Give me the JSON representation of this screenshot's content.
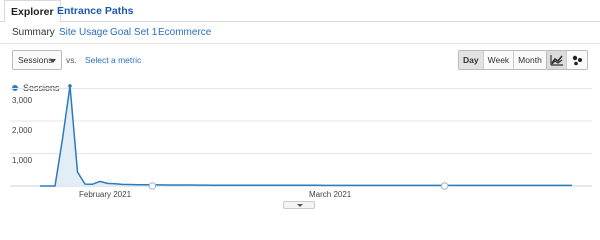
{
  "tabs": [
    {
      "label": "Explorer",
      "active": true
    },
    {
      "label": "Entrance Paths",
      "active": false
    }
  ],
  "subnav": [
    "Summary",
    "Site Usage",
    "Goal Set 1",
    "Ecommerce"
  ],
  "controls": {
    "metric_selected": "Sessions",
    "vs_label": "vs.",
    "select_metric_link": "Select a metric",
    "periods": [
      "Day",
      "Week",
      "Month"
    ],
    "active_period": "Day",
    "chart_type_icons": [
      "line-chart-icon",
      "motion-chart-icon"
    ]
  },
  "colors": {
    "series": "#2b7bbf",
    "fill": "#e3edf6",
    "link": "#2a6fc0",
    "grid": "#e6e6e6"
  },
  "chart_data": {
    "type": "area",
    "legend": [
      "Sessions"
    ],
    "yticks": [
      "3,000",
      "2,000",
      "1,000"
    ],
    "ylim": [
      0,
      3200
    ],
    "xtick_labels": [
      "February 2021",
      "March 2021"
    ],
    "series": [
      {
        "name": "Sessions",
        "values": [
          0,
          0,
          0,
          1450,
          3080,
          430,
          60,
          55,
          140,
          80,
          70,
          50,
          45,
          40,
          40,
          35,
          35,
          30,
          30,
          30,
          30,
          28,
          28,
          25,
          25,
          25,
          25,
          25,
          25,
          22,
          22,
          22,
          20,
          20,
          20,
          20,
          20,
          20,
          18,
          18,
          18,
          18,
          18,
          18,
          18,
          18,
          18,
          18,
          18,
          18,
          18,
          18,
          18,
          18,
          18,
          18,
          18,
          18,
          18,
          18,
          18,
          18,
          18,
          18,
          18,
          18,
          18,
          18,
          18,
          18,
          18,
          18
        ]
      }
    ],
    "annotation_markers": [
      15,
      54
    ]
  }
}
